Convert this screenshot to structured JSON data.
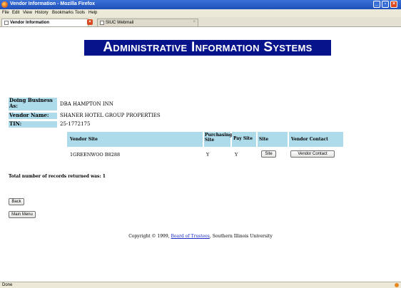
{
  "window": {
    "title": "Vendor Information - Mozilla Firefox"
  },
  "menu": [
    "File",
    "Edit",
    "View",
    "History",
    "Bookmarks",
    "Tools",
    "Help"
  ],
  "tabs": [
    {
      "label": "Vendor Information",
      "active": true
    },
    {
      "label": "SIUC Webmail",
      "active": false
    }
  ],
  "page": {
    "banner": "Administrative Information Systems",
    "info": {
      "dba_label": "Doing Business As:",
      "dba_value": "DBA HAMPTON INN",
      "vendor_name_label": "Vendor Name:",
      "vendor_name_value": "SHANER HOTEL GROUP PROPERTIES",
      "tin_label": "TIN:",
      "tin_value": "25-1772175"
    },
    "table": {
      "headers": {
        "vendor_site": "Vendor Site",
        "purchasing_site": "Purchasing Site",
        "pay_site": "Pay Site",
        "site": "Site",
        "vendor_contact": "Vendor Contact"
      },
      "rows": [
        {
          "vendor_site": "1GREENWOO B8288",
          "purchasing_site": "Y",
          "pay_site": "Y",
          "site_button": "Site",
          "vendor_contact_button": "Vendor Contact"
        }
      ]
    },
    "summary": "Total number of records returned was: 1",
    "back_button": "Back",
    "main_menu_button": "Main Menu",
    "footer": {
      "prefix": "Copyright © 1999,",
      "link": "Board of Trustees",
      "suffix": ", Southern Illinois University"
    }
  },
  "status": {
    "text": "Done"
  },
  "colors": {
    "banner_bg": "#06138a",
    "label_bg": "#aedbea",
    "link": "#1a29c9",
    "titlebar": "#2a5fcf"
  }
}
